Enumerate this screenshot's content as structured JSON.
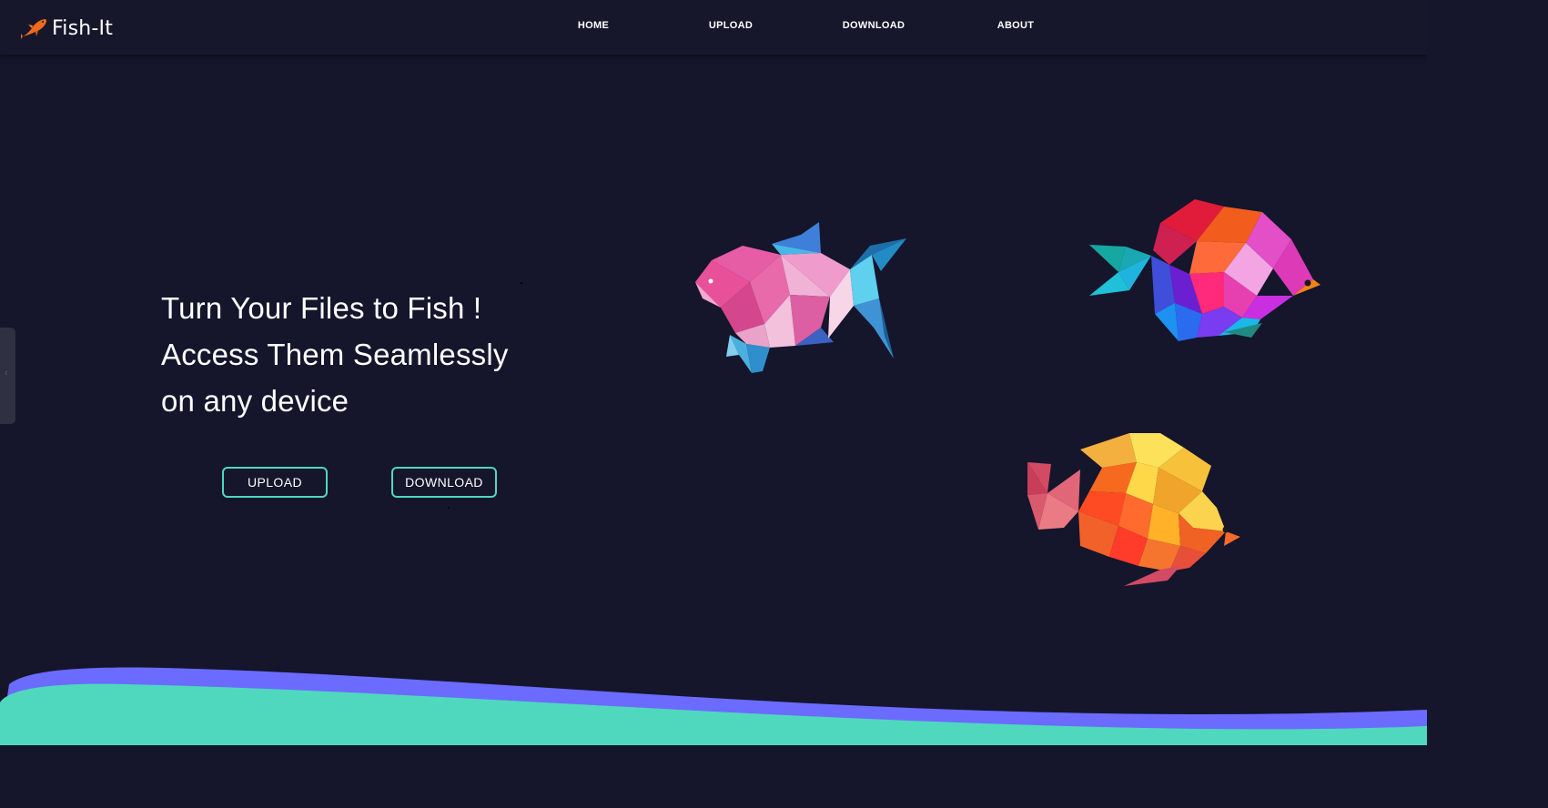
{
  "brand": {
    "name": "Fish-It",
    "logo_icon": "fish-logo-icon"
  },
  "nav": {
    "items": [
      {
        "label": "HOME"
      },
      {
        "label": "UPLOAD"
      },
      {
        "label": "DOWNLOAD"
      },
      {
        "label": "ABOUT"
      }
    ]
  },
  "hero": {
    "lines": [
      "Turn Your Files to Fish !",
      "Access Them Seamlessly",
      "on any device"
    ],
    "buttons": {
      "upload_label": "UPLOAD",
      "download_label": "DOWNLOAD"
    }
  },
  "side_tab": {
    "icon": "chevron-left-icon",
    "glyph": "‹"
  },
  "colors": {
    "background": "#15152c",
    "navbar": "#16172b",
    "button_border": "#4fd8bd",
    "wave_teal": "#4fd8bd",
    "wave_purple": "#6b6bff"
  }
}
